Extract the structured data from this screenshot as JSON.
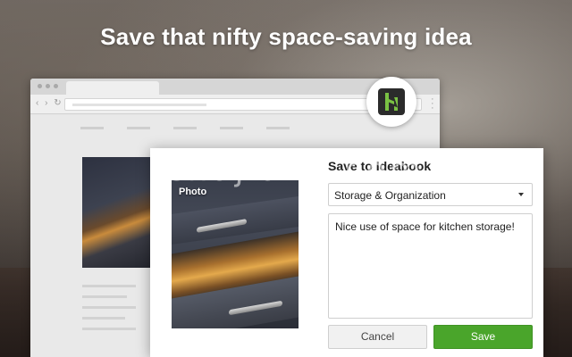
{
  "headline": "Save that nifty space-saving idea",
  "colors": {
    "accent_green": "#4aa52b",
    "extension_icon_bg": "#2b2b2b",
    "extension_icon_fg": "#7ac143"
  },
  "extension": {
    "icon": "houzz-logo-icon"
  },
  "dialog": {
    "title": "Save to Ideabook",
    "photo_label": "Photo",
    "ideabook_select": {
      "selected": "Storage & Organization"
    },
    "note_value": "Nice use of space for kitchen storage!",
    "cancel_label": "Cancel",
    "save_label": "Save"
  },
  "watermark": "chajian5.com"
}
